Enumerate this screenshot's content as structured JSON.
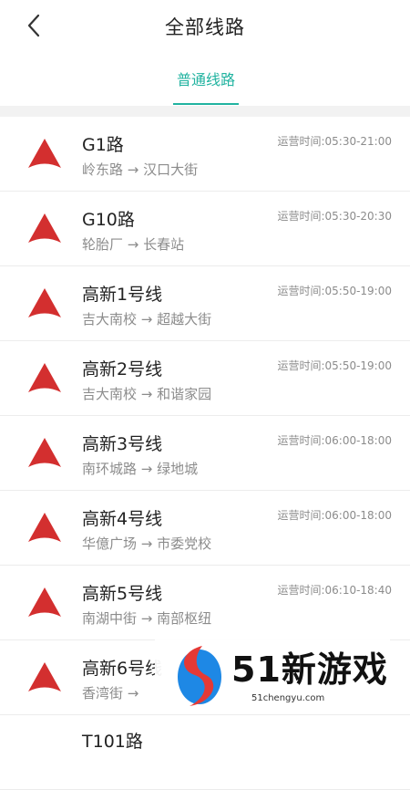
{
  "header": {
    "title": "全部线路",
    "back_icon": "chevron-left-icon"
  },
  "tabs": [
    {
      "label": "普通线路",
      "active": true
    }
  ],
  "colors": {
    "accent": "#21b3a0",
    "route_icon": "#d32f2f",
    "separator": "#f2f2f2"
  },
  "routes": [
    {
      "name": "G1路",
      "from": "岭东路",
      "to": "汉口大街",
      "arrow": "→",
      "time_label": "运营时间:",
      "time": "05:30-21:00"
    },
    {
      "name": "G10路",
      "from": "轮胎厂",
      "to": "长春站",
      "arrow": "→",
      "time_label": "运营时间:",
      "time": "05:30-20:30"
    },
    {
      "name": "高新1号线",
      "from": "吉大南校",
      "to": "超越大街",
      "arrow": "→",
      "time_label": "运营时间:",
      "time": "05:50-19:00"
    },
    {
      "name": "高新2号线",
      "from": "吉大南校",
      "to": "和谐家园",
      "arrow": "→",
      "time_label": "运营时间:",
      "time": "05:50-19:00"
    },
    {
      "name": "高新3号线",
      "from": "南环城路",
      "to": "绿地城",
      "arrow": "→",
      "time_label": "运营时间:",
      "time": "06:00-18:00"
    },
    {
      "name": "高新4号线",
      "from": "华億广场",
      "to": "市委党校",
      "arrow": "→",
      "time_label": "运营时间:",
      "time": "06:00-18:00"
    },
    {
      "name": "高新5号线",
      "from": "南湖中街",
      "to": "南部枢纽",
      "arrow": "→",
      "time_label": "运营时间:",
      "time": "06:10-18:40"
    },
    {
      "name": "高新6号线",
      "from": "香湾街",
      "to": "",
      "arrow": "→",
      "time_label": "",
      "time": ""
    },
    {
      "name": "T101路",
      "from": "",
      "to": "",
      "arrow": "",
      "time_label": "",
      "time": ""
    }
  ],
  "watermark": {
    "brand": "51新游戏",
    "url": "51chengyu.com"
  }
}
